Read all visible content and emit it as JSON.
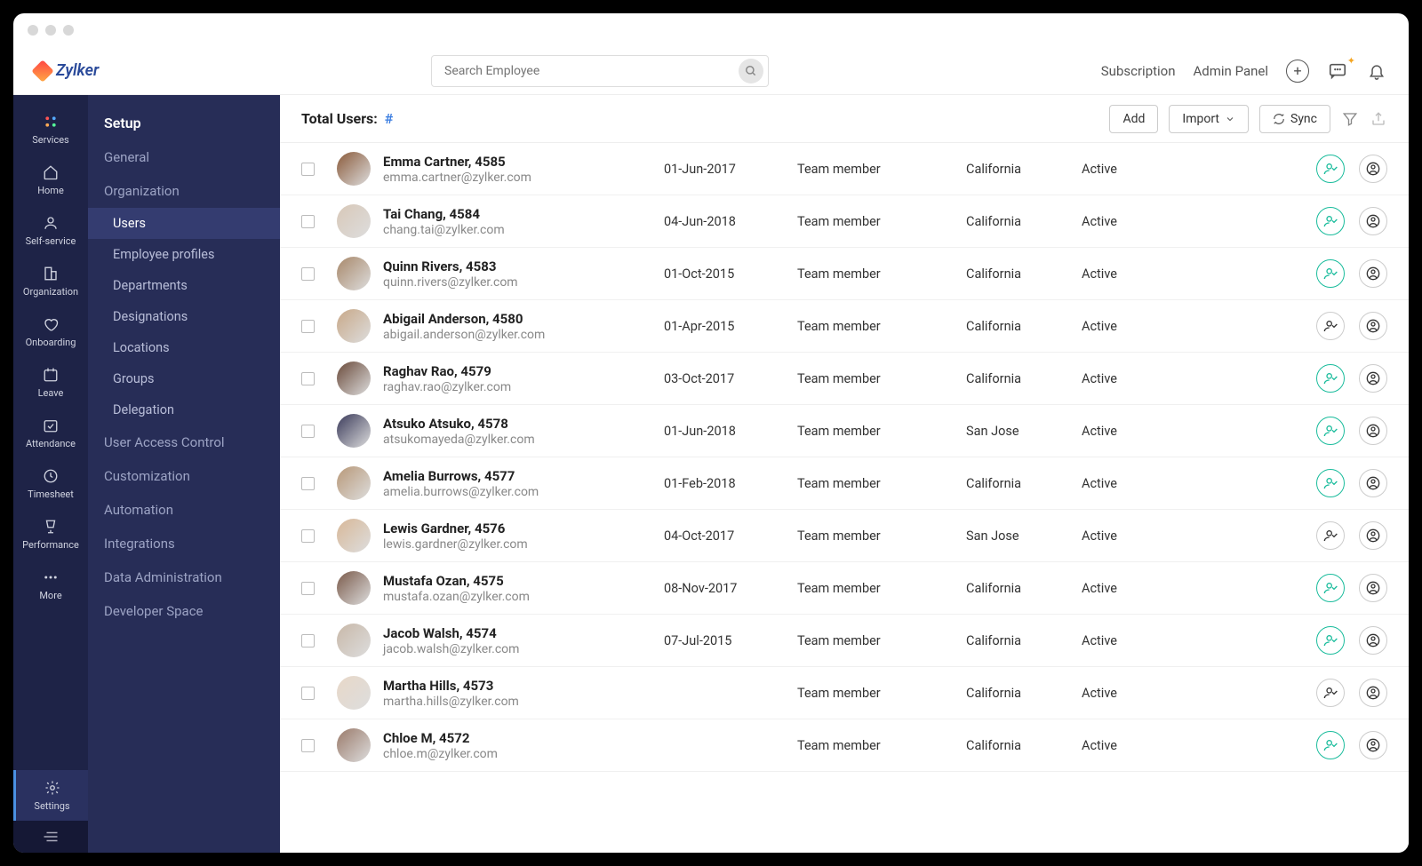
{
  "brand": "Zylker",
  "search": {
    "placeholder": "Search Employee"
  },
  "topnav": {
    "subscription": "Subscription",
    "admin_panel": "Admin Panel"
  },
  "rail": [
    {
      "id": "services",
      "label": "Services"
    },
    {
      "id": "home",
      "label": "Home"
    },
    {
      "id": "self-service",
      "label": "Self-service"
    },
    {
      "id": "organization",
      "label": "Organization"
    },
    {
      "id": "onboarding",
      "label": "Onboarding"
    },
    {
      "id": "leave",
      "label": "Leave"
    },
    {
      "id": "attendance",
      "label": "Attendance"
    },
    {
      "id": "timesheet",
      "label": "Timesheet"
    },
    {
      "id": "performance",
      "label": "Performance"
    },
    {
      "id": "more",
      "label": "More"
    }
  ],
  "rail_settings": "Settings",
  "sidebar": {
    "setup": "Setup",
    "general": "General",
    "organization": "Organization",
    "org_items": [
      "Users",
      "Employee profiles",
      "Departments",
      "Designations",
      "Locations",
      "Groups",
      "Delegation"
    ],
    "uac": "User Access Control",
    "customization": "Customization",
    "automation": "Automation",
    "integrations": "Integrations",
    "data_admin": "Data Administration",
    "dev_space": "Developer Space"
  },
  "toolbar": {
    "total_label": "Total Users:",
    "hash": "#",
    "add": "Add",
    "import": "Import",
    "sync": "Sync"
  },
  "users": [
    {
      "name": "Emma Cartner, 4585",
      "email": "emma.cartner@zylker.com",
      "date": "01-Jun-2017",
      "role": "Team member",
      "loc": "California",
      "status": "Active",
      "teal": true
    },
    {
      "name": "Tai Chang, 4584",
      "email": "chang.tai@zylker.com",
      "date": "04-Jun-2018",
      "role": "Team member",
      "loc": "California",
      "status": "Active",
      "teal": true
    },
    {
      "name": "Quinn Rivers, 4583",
      "email": "quinn.rivers@zylker.com",
      "date": "01-Oct-2015",
      "role": "Team member",
      "loc": "California",
      "status": "Active",
      "teal": true
    },
    {
      "name": "Abigail Anderson, 4580",
      "email": "abigail.anderson@zylker.com",
      "date": "01-Apr-2015",
      "role": "Team member",
      "loc": "California",
      "status": "Active",
      "teal": false
    },
    {
      "name": "Raghav Rao, 4579",
      "email": "raghav.rao@zylker.com",
      "date": "03-Oct-2017",
      "role": "Team member",
      "loc": "California",
      "status": "Active",
      "teal": true
    },
    {
      "name": "Atsuko Atsuko, 4578",
      "email": "atsukomayeda@zylker.com",
      "date": "01-Jun-2018",
      "role": "Team member",
      "loc": "San Jose",
      "status": "Active",
      "teal": true
    },
    {
      "name": "Amelia Burrows, 4577",
      "email": "amelia.burrows@zylker.com",
      "date": "01-Feb-2018",
      "role": "Team member",
      "loc": "California",
      "status": "Active",
      "teal": true
    },
    {
      "name": "Lewis Gardner, 4576",
      "email": "lewis.gardner@zylker.com",
      "date": "04-Oct-2017",
      "role": "Team member",
      "loc": "San Jose",
      "status": "Active",
      "teal": false
    },
    {
      "name": "Mustafa Ozan, 4575",
      "email": "mustafa.ozan@zylker.com",
      "date": "08-Nov-2017",
      "role": "Team member",
      "loc": "California",
      "status": "Active",
      "teal": true
    },
    {
      "name": "Jacob Walsh, 4574",
      "email": "jacob.walsh@zylker.com",
      "date": "07-Jul-2015",
      "role": "Team member",
      "loc": "California",
      "status": "Active",
      "teal": true
    },
    {
      "name": "Martha Hills, 4573",
      "email": "martha.hills@zylker.com",
      "date": "",
      "role": "Team member",
      "loc": "California",
      "status": "Active",
      "teal": false
    },
    {
      "name": "Chloe M, 4572",
      "email": "chloe.m@zylker.com",
      "date": "",
      "role": "Team member",
      "loc": "California",
      "status": "Active",
      "teal": true
    }
  ]
}
